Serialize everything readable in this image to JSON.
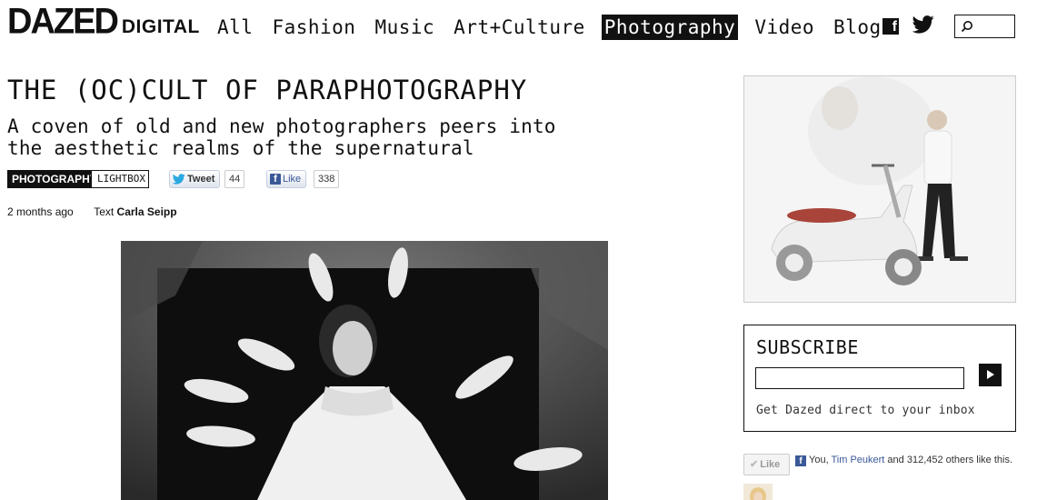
{
  "header": {
    "logo_main": "DAZED",
    "logo_sub": "DIGITAL",
    "nav": [
      {
        "label": "All",
        "active": false
      },
      {
        "label": "Fashion",
        "active": false
      },
      {
        "label": "Music",
        "active": false
      },
      {
        "label": "Art+Culture",
        "active": false
      },
      {
        "label": "Photography",
        "active": true
      },
      {
        "label": "Video",
        "active": false
      },
      {
        "label": "Blogs",
        "active": false
      }
    ],
    "social_icons": [
      "facebook-icon",
      "twitter-icon"
    ],
    "search_icon": "search-icon"
  },
  "article": {
    "title": "THE (OC)CULT OF PARAPHOTOGRAPHY",
    "subtitle": "A coven of old and new photographers peers into the aesthetic realms of the supernatural",
    "tags": {
      "primary": "PHOTOGRAPHY",
      "secondary": "LIGHTBOX"
    },
    "share": {
      "tweet_label": "Tweet",
      "tweet_count": "44",
      "like_label": "Like",
      "like_count": "338"
    },
    "meta": {
      "time_ago": "2 months ago",
      "text_label": "Text",
      "author": "Carla Seipp"
    }
  },
  "sidebar": {
    "subscribe": {
      "title": "SUBSCRIBE",
      "input_value": "",
      "tagline": "Get Dazed direct to your inbox"
    },
    "facebook": {
      "like_label": "Like",
      "prefix": "You, ",
      "friend": "Tim Peukert",
      "suffix": " and 312,452 others like this."
    }
  },
  "colors": {
    "brand": "#111111",
    "facebook": "#3b5998",
    "border": "#cccccc"
  }
}
